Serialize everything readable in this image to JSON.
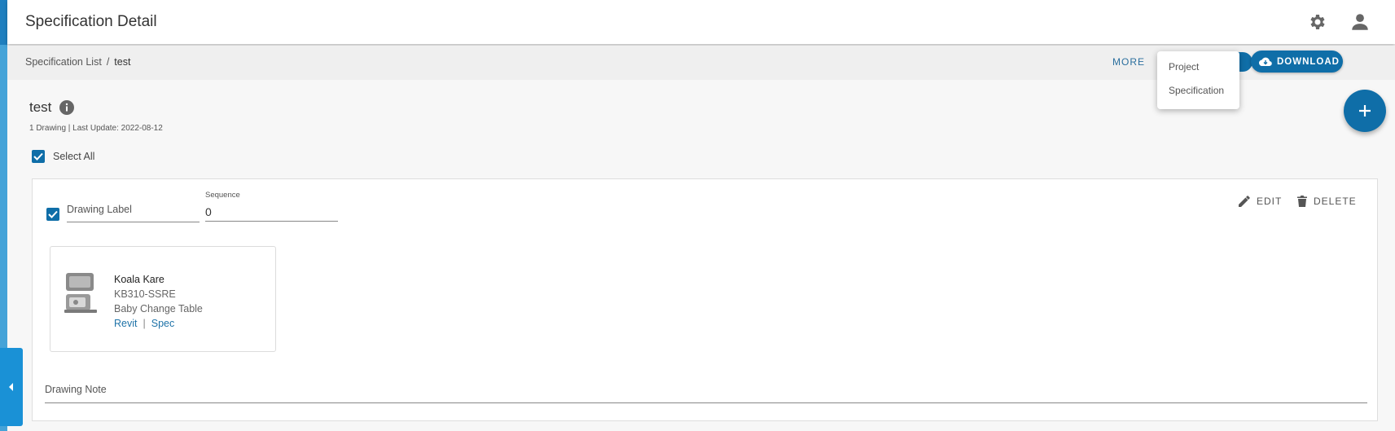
{
  "header": {
    "title": "Specification Detail"
  },
  "breadcrumb": {
    "parent": "Specification List",
    "separator": "/",
    "current": "test"
  },
  "actions": {
    "more_label": "MORE",
    "download_label": "DOWNLOAD"
  },
  "dropdown": {
    "items": [
      {
        "label": "Project"
      },
      {
        "label": "Specification"
      }
    ]
  },
  "spec": {
    "title": "test",
    "meta": "1 Drawing | Last Update: 2022-08-12"
  },
  "select_all": {
    "label": "Select All",
    "checked": true
  },
  "drawing": {
    "checked": true,
    "label_placeholder": "Drawing Label",
    "sequence_label": "Sequence",
    "sequence_value": "0",
    "edit_label": "EDIT",
    "delete_label": "DELETE",
    "note_placeholder": "Drawing Note",
    "product": {
      "brand": "Koala Kare",
      "model": "KB310-SSRE",
      "name": "Baby Change Table",
      "link_revit": "Revit",
      "link_separator": "|",
      "link_spec": "Spec"
    }
  },
  "colors": {
    "primary": "#0f6ea8",
    "sidebar": "#1e7fbf",
    "link": "#1f73a8"
  }
}
